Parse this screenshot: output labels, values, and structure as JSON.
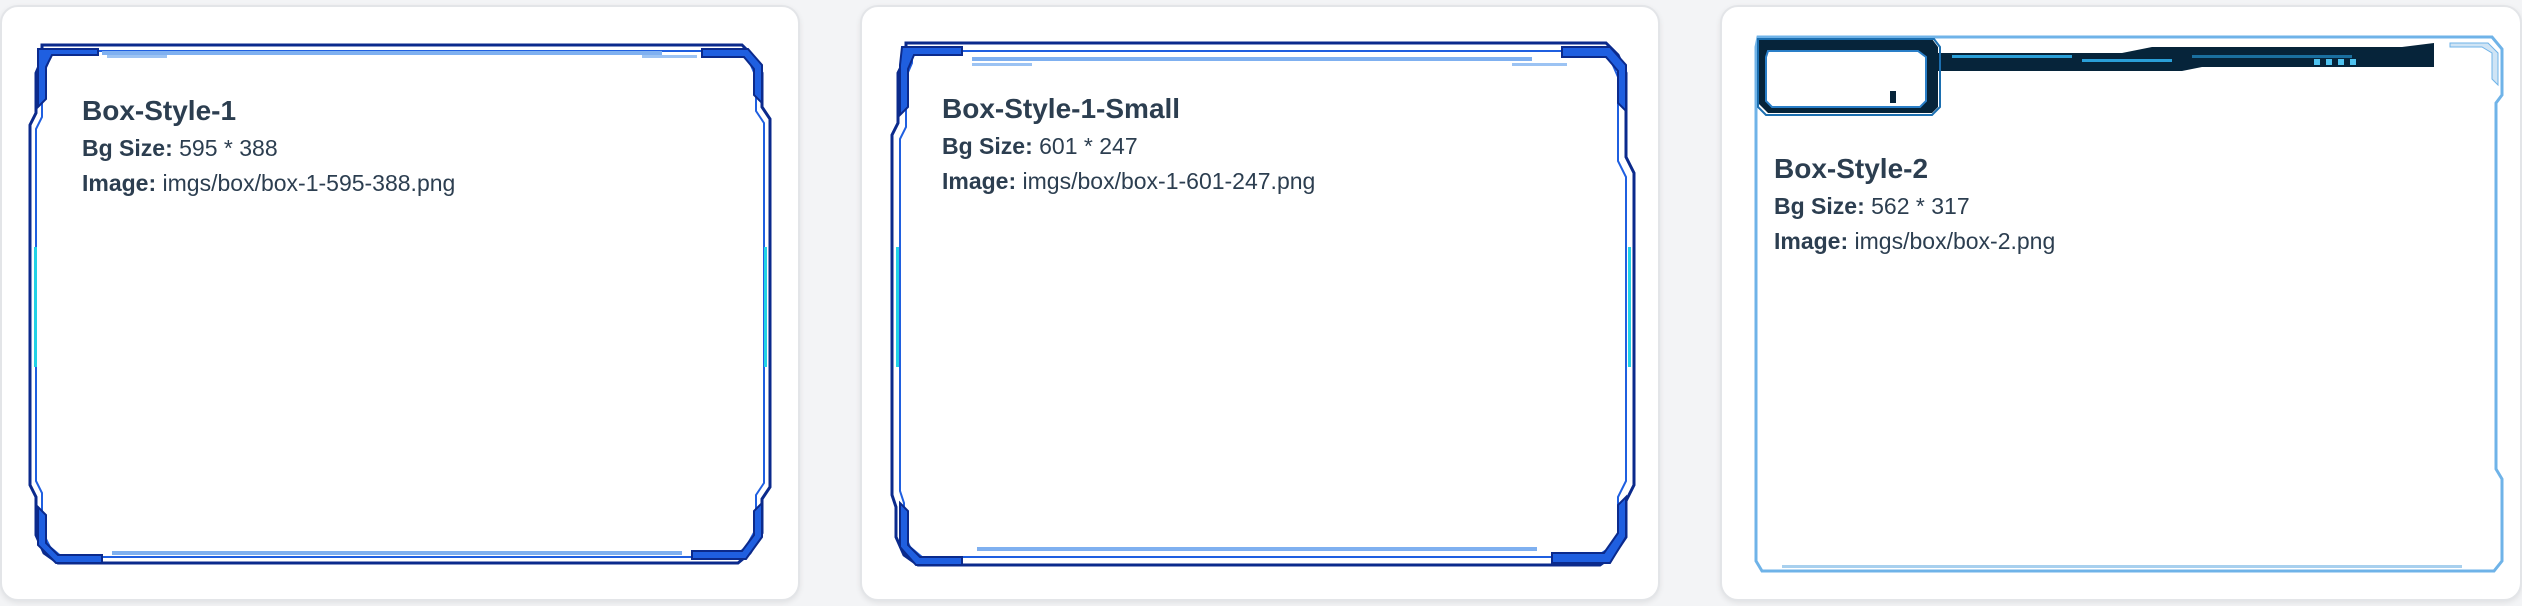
{
  "cards": [
    {
      "name": "box-style-1",
      "title": "Box-Style-1",
      "bg_size_label": "Bg Size:",
      "bg_size_value": "595 * 388",
      "image_label": "Image:",
      "image_value": "imgs/box/box-1-595-388.png",
      "frame_icon": "scifi-corner-frame"
    },
    {
      "name": "box-style-1-small",
      "title": "Box-Style-1-Small",
      "bg_size_label": "Bg Size:",
      "bg_size_value": "601 * 247",
      "image_label": "Image:",
      "image_value": "imgs/box/box-1-601-247.png",
      "frame_icon": "scifi-corner-frame"
    },
    {
      "name": "box-style-2",
      "title": "Box-Style-2",
      "bg_size_label": "Bg Size:",
      "bg_size_value": "562 * 317",
      "image_label": "Image:",
      "image_value": "imgs/box/box-2.png",
      "frame_icon": "scifi-tab-header-frame"
    }
  ],
  "colors": {
    "frame_dark": "#0b2a8c",
    "frame_mid": "#1f5fe0",
    "frame_light": "#7fb0f0",
    "accent_cyan": "#22d3e6",
    "frame2_dark": "#06243a",
    "frame2_line": "#6fb3e8",
    "text": "#2c3e50"
  }
}
